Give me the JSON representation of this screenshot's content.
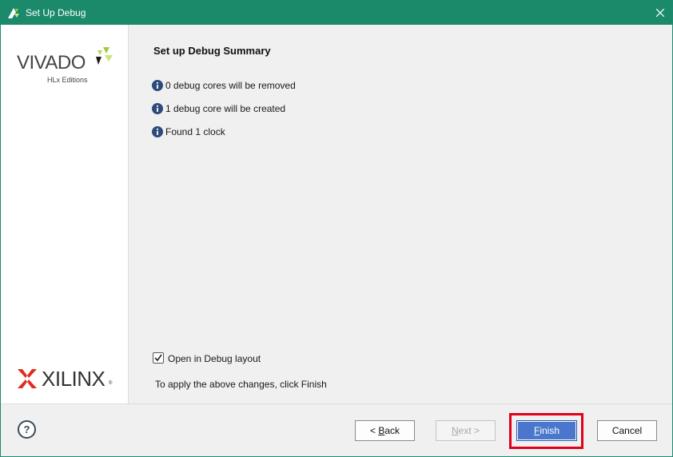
{
  "window": {
    "title": "Set Up Debug"
  },
  "branding": {
    "product_name": "VIVADO",
    "product_edition": "HLx Editions",
    "company_name": "XILINX",
    "registered_mark": "®"
  },
  "summary": {
    "heading": "Set up Debug Summary",
    "messages": [
      {
        "icon": "info-icon",
        "text": "0 debug cores will be removed"
      },
      {
        "icon": "info-icon",
        "text": "1 debug core will be created"
      },
      {
        "icon": "info-icon",
        "text": "Found 1 clock"
      }
    ]
  },
  "options": {
    "open_debug_layout_label": "Open in Debug layout",
    "open_debug_layout_checked": true,
    "apply_hint": "To apply the above changes, click Finish"
  },
  "footer": {
    "help_label": "?",
    "back": {
      "prefix": "< ",
      "mnemonic": "B",
      "rest": "ack"
    },
    "next": {
      "mnemonic": "N",
      "rest": "ext >",
      "enabled": false
    },
    "finish": {
      "mnemonic": "F",
      "rest": "inish",
      "highlighted": true
    },
    "cancel_label": "Cancel"
  },
  "colors": {
    "titlebar": "#1b8a6b",
    "finish_button": "#4a77cc",
    "highlight_box": "#e0001a"
  }
}
